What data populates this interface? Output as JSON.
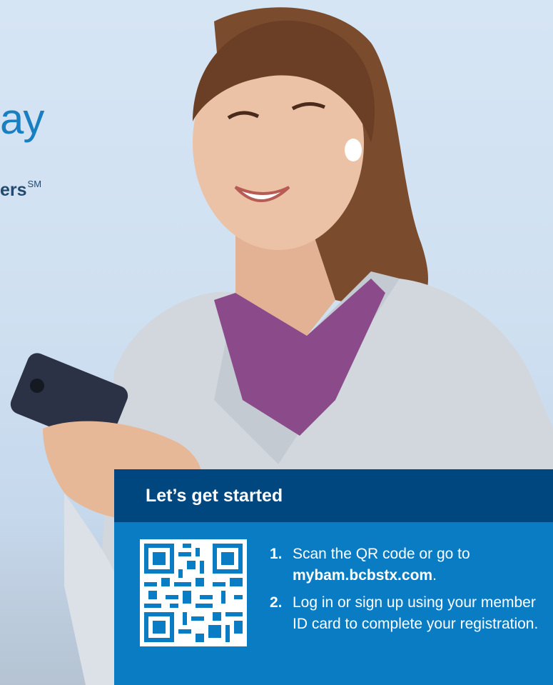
{
  "hero": {
    "headline_fragment": "ay",
    "subhead_fragment": "ers",
    "subhead_mark": "SM"
  },
  "card": {
    "title": "Let’s get started",
    "steps": [
      {
        "number": "1.",
        "text_before": "Scan the QR code or go to ",
        "link": "mybam.bcbstx.com",
        "text_after": "."
      },
      {
        "number": "2.",
        "text": "Log in or sign up using your member ID card to complete your registration."
      }
    ]
  },
  "colors": {
    "headline": "#1a7fc0",
    "card_header": "#00477f",
    "card_body": "#0a7cc4"
  },
  "icons": {
    "qr": "qr-code-icon"
  }
}
